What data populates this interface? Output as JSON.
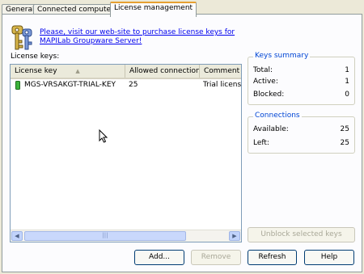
{
  "tabs": [
    "General",
    "Connected computers",
    "License management"
  ],
  "link_text": "Please, visit our web-site to purchase license keys for MAPILab Groupware Server!",
  "license_keys_label": "License keys:",
  "columns": [
    "License key",
    "Allowed connections",
    "Comment"
  ],
  "rows": [
    {
      "key": "MGS-VRSAKGT-TRIAL-KEY",
      "allowed": "25",
      "comment": "Trial license"
    }
  ],
  "keys_summary": {
    "title": "Keys summary",
    "total_label": "Total:",
    "total": "1",
    "active_label": "Active:",
    "active": "1",
    "blocked_label": "Blocked:",
    "blocked": "0"
  },
  "connections": {
    "title": "Connections",
    "available_label": "Available:",
    "available": "25",
    "left_label": "Left:",
    "left": "25"
  },
  "buttons": {
    "unblock": "Unblock selected keys",
    "add": "Add...",
    "remove": "Remove",
    "refresh": "Refresh",
    "help": "Help"
  },
  "colors": {
    "link": "#0000ee",
    "group_title": "#0046d5",
    "active_tab_accent": "#e6a031"
  }
}
